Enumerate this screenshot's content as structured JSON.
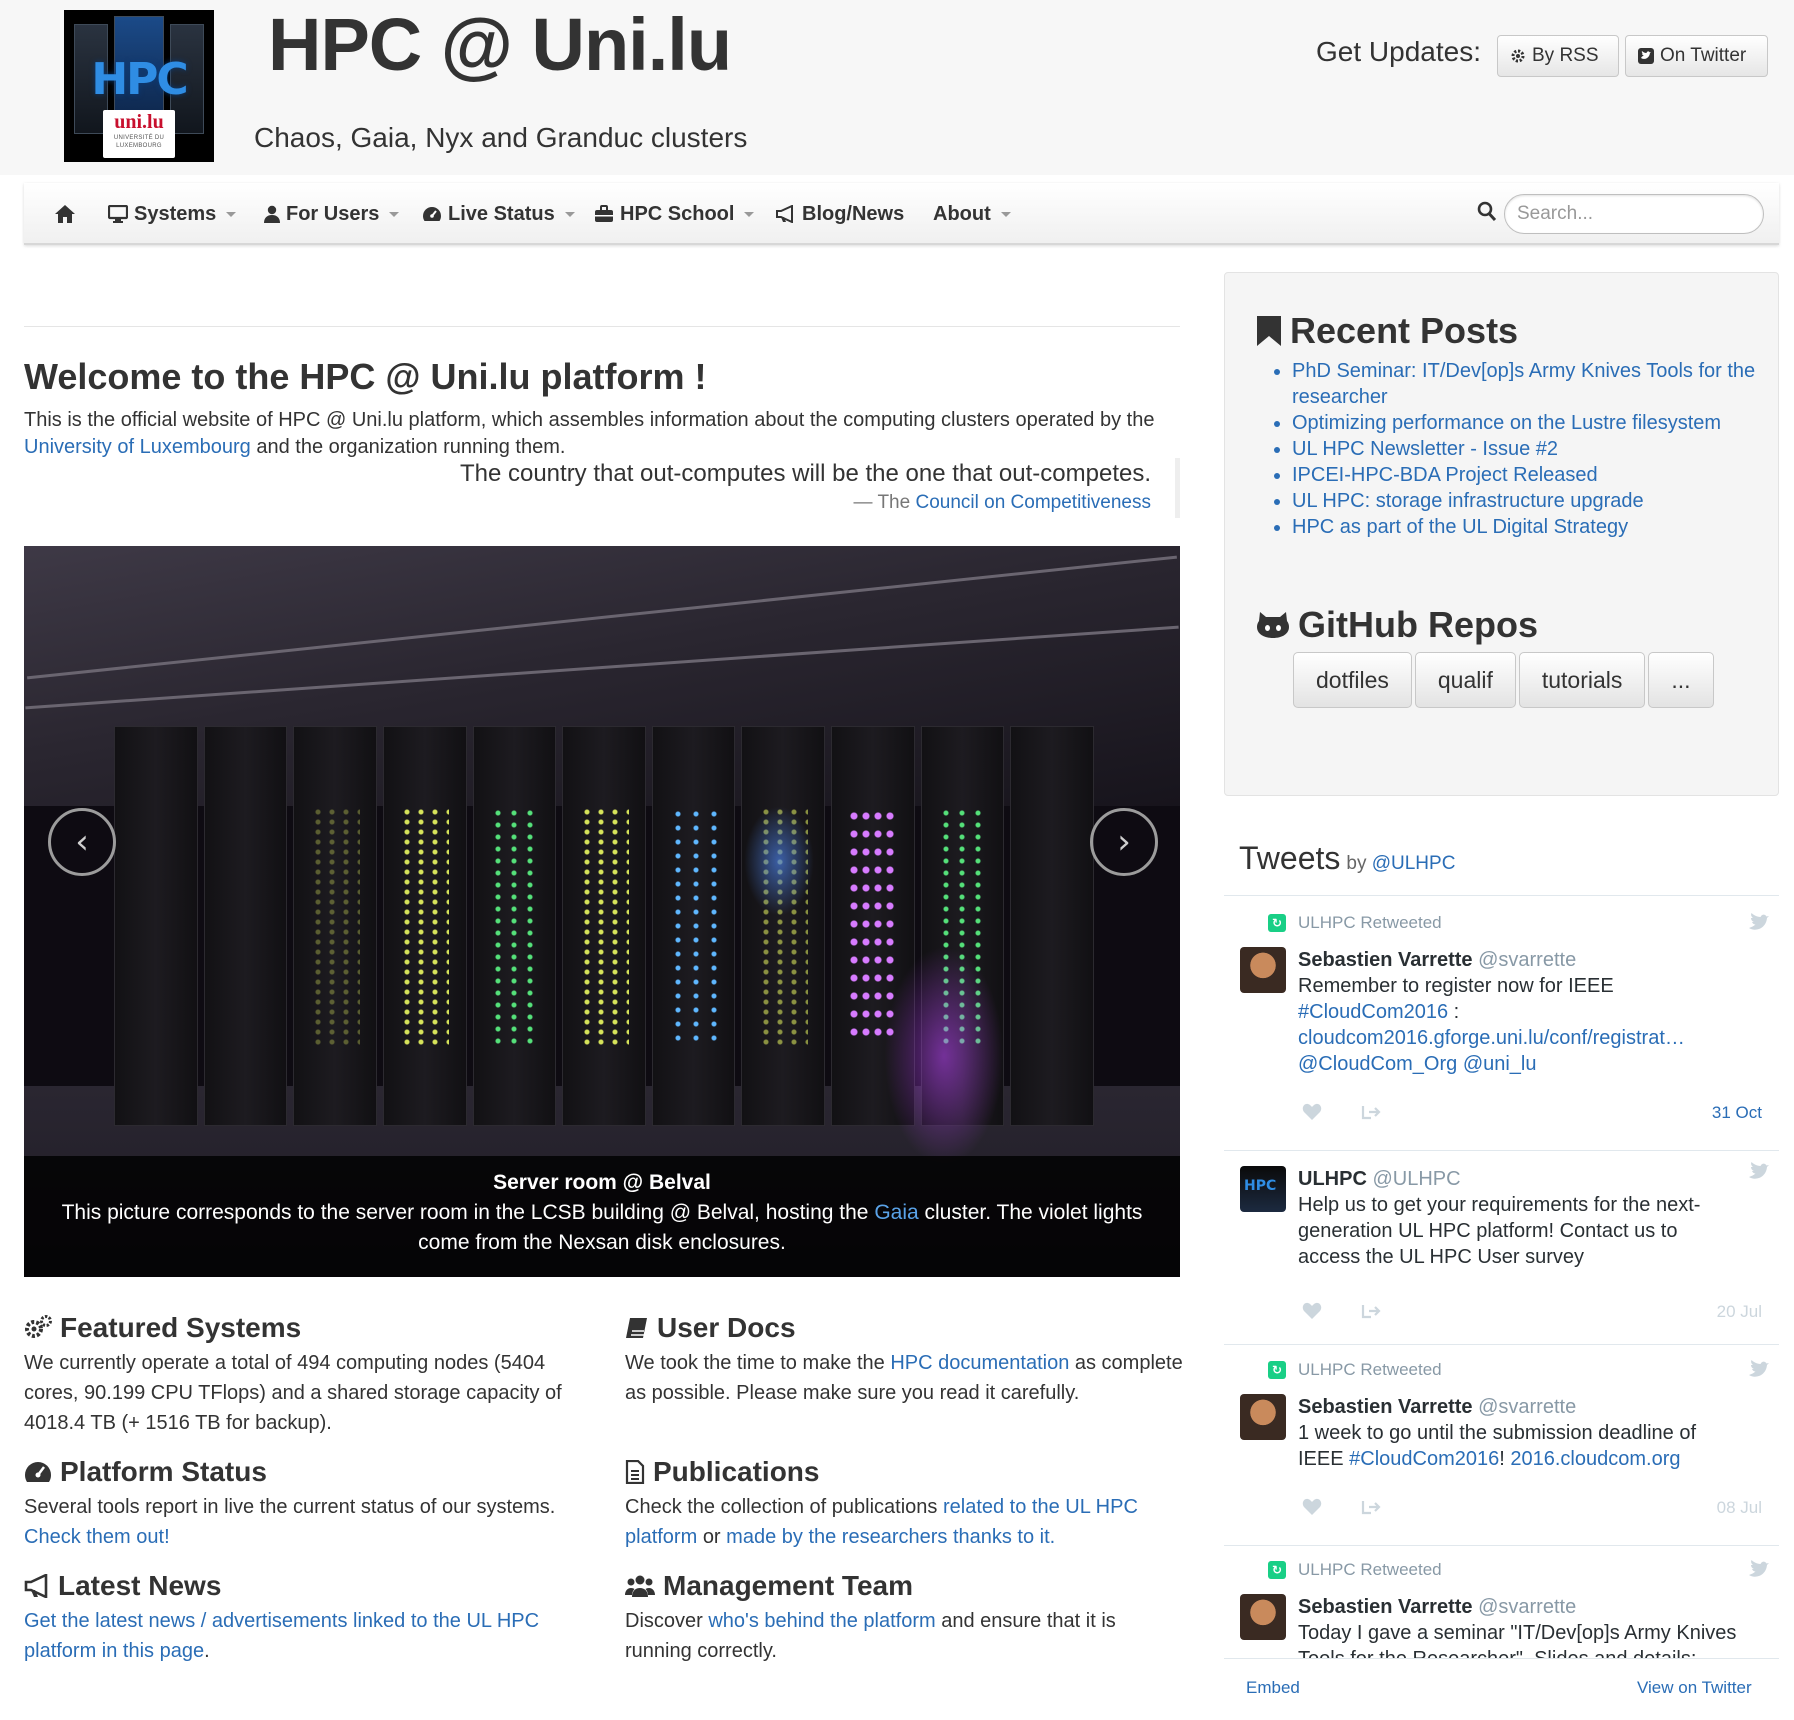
{
  "header": {
    "logo": {
      "text": "HPC",
      "badge_text": "uni.lu",
      "badge_subtext": "UNIVERSITÉ DU LUXEMBOURG"
    },
    "title": "HPC @ Uni.lu",
    "tagline": "Chaos, Gaia, Nyx and Granduc clusters",
    "updates_label": "Get Updates:",
    "rss_label": "By RSS",
    "twitter_label": "On Twitter"
  },
  "nav": {
    "items": [
      {
        "label": "",
        "icon": "home-icon"
      },
      {
        "label": "Systems",
        "icon": "desktop-icon",
        "dropdown": true
      },
      {
        "label": "For Users",
        "icon": "user-icon",
        "dropdown": true
      },
      {
        "label": "Live Status",
        "icon": "dashboard-icon",
        "dropdown": true
      },
      {
        "label": "HPC School",
        "icon": "briefcase-icon",
        "dropdown": true
      },
      {
        "label": "Blog/News",
        "icon": "bullhorn-icon",
        "dropdown": false
      },
      {
        "label": "About",
        "icon": "",
        "dropdown": true
      }
    ],
    "search_placeholder": "Search..."
  },
  "main": {
    "welcome_title": "Welcome to the HPC @ Uni.lu platform !",
    "intro_text": "This is the official website of HPC @ Uni.lu platform, which assembles information about the computing clusters operated by the",
    "intro_link": "University of Luxembourg",
    "intro_tail": "and the organization running them.",
    "quote": {
      "text": "The country that out-computes will be the one that out-competes.",
      "source_prefix": "— The",
      "source_link": "Council on Competitiveness"
    },
    "carousel": {
      "prev_glyph": "‹",
      "next_glyph": "›",
      "caption_title": "Server room @ Belval",
      "caption_pre": "This picture corresponds to the server room in the LCSB building @ Belval, hosting the",
      "caption_link": "Gaia",
      "caption_post": "cluster. The violet lights come from the Nexsan disk enclosures."
    },
    "features": {
      "featured_systems": {
        "title": "Featured Systems",
        "text": "We currently operate a total of 494 computing nodes (5404 cores, 90.199 CPU TFlops) and a shared storage capacity of 4018.4 TB (+ 1516 TB for backup)."
      },
      "user_docs": {
        "title": "User Docs",
        "pre": "We took the time to make the",
        "link": "HPC documentation",
        "post": "as complete as possible. Please make sure you read it carefully."
      },
      "platform_status": {
        "title": "Platform Status",
        "pre": "Several tools report in live the current status of our systems.",
        "link": "Check them out!"
      },
      "publications": {
        "title": "Publications",
        "pre": "Check the collection of publications",
        "link1": "related to the UL HPC platform",
        "mid": "or",
        "link2": "made by the researchers thanks to it."
      },
      "latest_news": {
        "title": "Latest News",
        "link": "Get the latest news / advertisements linked to the UL HPC platform in this page",
        "post": "."
      },
      "management_team": {
        "title": "Management Team",
        "pre": "Discover",
        "link": "who's behind the platform",
        "post": "and ensure that it is running correctly."
      }
    }
  },
  "sidebar": {
    "recent_posts_title": "Recent Posts",
    "posts": [
      "PhD Seminar: IT/Dev[op]s Army Knives Tools for the researcher",
      "Optimizing performance on the Lustre filesystem",
      "UL HPC Newsletter - Issue #2",
      "IPCEI-HPC-BDA Project Released",
      "UL HPC: storage infrastructure upgrade",
      "HPC as part of the UL Digital Strategy"
    ],
    "github_title": "GitHub Repos",
    "repos": [
      "dotfiles",
      "qualif",
      "tutorials",
      "..."
    ]
  },
  "tweets": {
    "title": "Tweets",
    "by_label": "by",
    "by_handle": "@ULHPC",
    "items": [
      {
        "retweeted": "ULHPC Retweeted",
        "name": "Sebastien Varrette",
        "handle": "@svarrette",
        "text_parts": [
          "Remember to register now for IEEE "
        ],
        "links": [
          "#CloudCom2016",
          "cloudcom2016.gforge.uni.lu/conf/registrat…",
          "@CloudCom_Org",
          "@uni_lu"
        ],
        "date": "31 Oct"
      },
      {
        "retweeted": "",
        "name": "ULHPC",
        "handle": "@ULHPC",
        "text": "Help us to get your requirements for the next-generation UL HPC platform! Contact us to access the UL HPC User survey",
        "date": "20 Jul"
      },
      {
        "retweeted": "ULHPC Retweeted",
        "name": "Sebastien Varrette",
        "handle": "@svarrette",
        "text_pre": "1 week to go until the submission deadline of IEEE",
        "links": [
          "#CloudCom2016",
          "2016.cloudcom.org"
        ],
        "text_mid": "!",
        "date": "08 Jul"
      },
      {
        "retweeted": "ULHPC Retweeted",
        "name": "Sebastien Varrette",
        "handle": "@svarrette",
        "text": "Today I gave a seminar \"IT/Dev[op]s Army Knives Tools for the Researcher\". Slides and details:"
      }
    ],
    "embed_label": "Embed",
    "view_label": "View on Twitter"
  },
  "colors": {
    "link": "#2a6db6",
    "retweet_green": "#19cf86",
    "twitter_grey": "#8899a6"
  }
}
